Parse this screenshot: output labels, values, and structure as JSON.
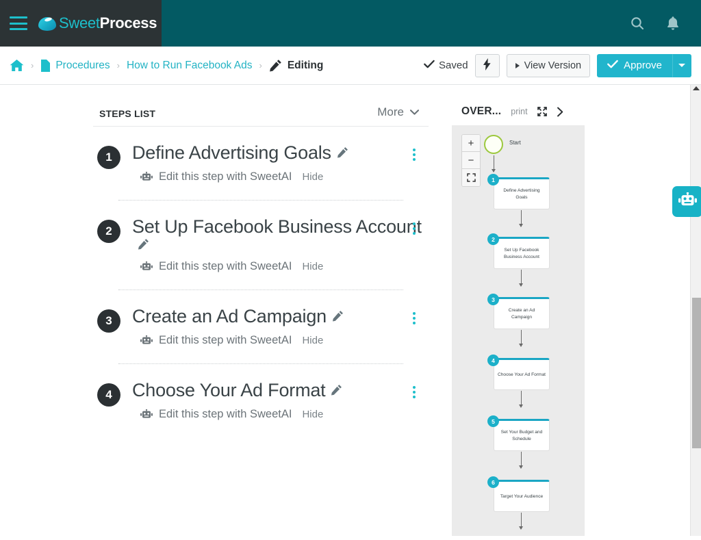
{
  "brand": {
    "logo_icon": "sweetprocess-bean-logo",
    "name_part1": "Sweet",
    "name_part2": "Process",
    "menu_icon": "hamburger-menu-icon",
    "bar_color": "#035a63",
    "brand_panel_color": "#2c3335",
    "accent_color": "#1dbfcb"
  },
  "topbar": {
    "search_icon": "search-icon",
    "notifications_icon": "bell-icon"
  },
  "breadcrumb": {
    "home_icon": "home-icon",
    "separator": "›",
    "items": [
      {
        "label": "Procedures",
        "icon": "document-icon"
      },
      {
        "label": "How to Run Facebook Ads",
        "icon": ""
      },
      {
        "label": "Editing",
        "icon": "pencil-icon"
      }
    ]
  },
  "doc_actions": {
    "saved_label": "Saved",
    "saved_icon": "check-icon",
    "bolt_icon": "lightning-bolt-icon",
    "view_version_label": "View Version",
    "view_version_icon": "triangle-right-icon",
    "approve_label": "Approve",
    "approve_icon": "check-icon",
    "approve_caret_icon": "caret-down-icon",
    "approve_color": "#21b5cc"
  },
  "steps_panel": {
    "title": "STEPS LIST",
    "more_label": "More",
    "more_icon": "chevron-down-icon",
    "kebab_icon": "kebab-menu-icon",
    "steps": [
      {
        "number": "1",
        "title": "Define Advertising Goals",
        "edit_icon": "pencil-icon",
        "ai_icon": "robot-icon",
        "ai_label": "Edit this step with SweetAI",
        "hide_label": "Hide"
      },
      {
        "number": "2",
        "title": "Set Up Facebook Business Account",
        "edit_icon": "pencil-icon",
        "ai_icon": "robot-icon",
        "ai_label": "Edit this step with SweetAI",
        "hide_label": "Hide"
      },
      {
        "number": "3",
        "title": "Create an Ad Campaign",
        "edit_icon": "pencil-icon",
        "ai_icon": "robot-icon",
        "ai_label": "Edit this step with SweetAI",
        "hide_label": "Hide"
      },
      {
        "number": "4",
        "title": "Choose Your Ad Format",
        "edit_icon": "pencil-icon",
        "ai_icon": "robot-icon",
        "ai_label": "Edit this step with SweetAI",
        "hide_label": "Hide"
      }
    ]
  },
  "overview_panel": {
    "title": "OVER...",
    "print_label": "print",
    "expand_icon": "expand-arrows-icon",
    "collapse_icon": "chevron-right-icon",
    "zoom_in_label": "+",
    "zoom_out_label": "−",
    "fit_icon": "fit-screen-icon",
    "start_label": "Start",
    "node_accent_color": "#1aa6c4",
    "badge_color": "#1cb0c9",
    "canvas_color": "#ebebeb",
    "nodes": [
      {
        "number": "1",
        "label": "Define Advertising Goals"
      },
      {
        "number": "2",
        "label": "Set Up Facebook Business Account"
      },
      {
        "number": "3",
        "label": "Create an Ad Campaign"
      },
      {
        "number": "4",
        "label": "Choose Your Ad Format"
      },
      {
        "number": "5",
        "label": "Set Your Budget and Schedule"
      },
      {
        "number": "6",
        "label": "Target Your Audience"
      }
    ]
  },
  "right_rail": {
    "scroll_up_icon": "scroll-up-arrow-icon",
    "scroll_thumb_icon": "scrollbar-thumb",
    "ai_fab_icon": "robot-icon"
  }
}
